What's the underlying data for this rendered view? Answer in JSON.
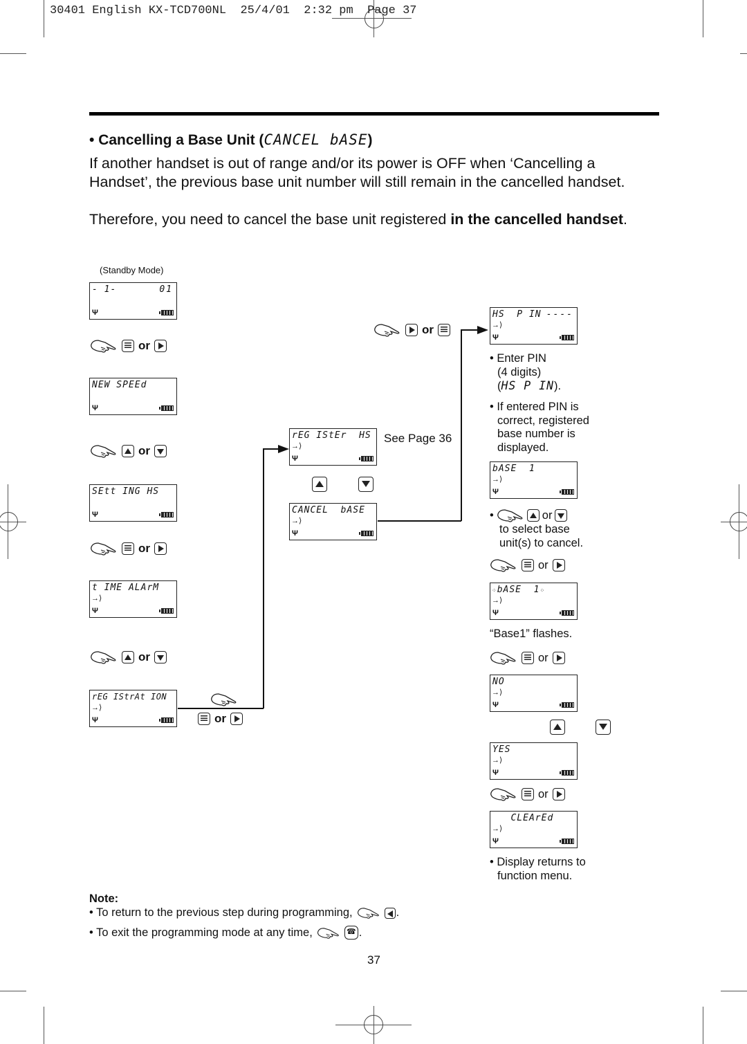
{
  "print_header": "30401 English KX-TCD700NL  25/4/01  2:32 pm  Page 37",
  "section": {
    "bullet": "•",
    "title": "Cancelling a Base Unit (",
    "title_lcd": "CANCEL bASE",
    "title_close": ")"
  },
  "intro": {
    "para1": "If another handset is out of range and/or its power is OFF when ‘Cancelling a Handset’, the previous base unit number will still remain in the cancelled handset.",
    "para2_plain": "Therefore, you need to cancel the base unit registered ",
    "para2_bold": "in the cancelled handset",
    "para2_end": "."
  },
  "standby_label": "(Standby Mode)",
  "or_label": "or",
  "left_column": {
    "displays": [
      {
        "line1": "- 1-",
        "right": "01",
        "arrow": false
      },
      {
        "line1": "NEW SPEEd",
        "arrow": false
      },
      {
        "line1": "SEtt ING HS",
        "arrow": false
      },
      {
        "line1": "t IME ALArM",
        "arrow": true
      },
      {
        "line1": "rEG IStrAt ION",
        "arrow": true
      }
    ],
    "steps": [
      {
        "keys": [
          "menu",
          "right"
        ]
      },
      {
        "keys": [
          "up",
          "down"
        ]
      },
      {
        "keys": [
          "menu",
          "right"
        ]
      },
      {
        "keys": [
          "up",
          "down"
        ]
      },
      {
        "keys": [
          "menu",
          "right"
        ]
      }
    ]
  },
  "middle_column": {
    "displays": [
      {
        "line1": "rEG IStEr  HS",
        "arrow": true
      },
      {
        "line1": "CANCEL  bASE",
        "arrow": true
      }
    ],
    "see_page": "See Page 36",
    "step_top": {
      "keys": [
        "right",
        "menu"
      ]
    }
  },
  "right_column": {
    "displays": [
      {
        "line1": "HS  P IN",
        "right": "----",
        "arrow": true
      },
      {
        "line1": "bASE  1",
        "arrow": true
      },
      {
        "line1": "bASE  1",
        "arrow": true,
        "flashing": true
      },
      {
        "line1": "NO",
        "arrow": true
      },
      {
        "line1": "YES",
        "arrow": true
      },
      {
        "line1": "   CLEArEd",
        "arrow": true
      }
    ],
    "enter_pin": "• Enter PIN",
    "enter_pin_digits": "(4 digits)",
    "enter_pin_lcd_open": "(",
    "enter_pin_lcd": "HS P IN",
    "enter_pin_lcd_close": ").",
    "pin_correct": [
      "• If entered PIN is",
      "correct, registered",
      "base number is",
      "displayed."
    ],
    "select_bullet": "•",
    "select_text": [
      "to select base",
      "unit(s) to cancel."
    ],
    "flashes": "“Base1” flashes.",
    "returns": [
      "• Display returns to",
      "function menu."
    ]
  },
  "note": {
    "title": "Note:",
    "items": [
      {
        "text": "• To return to the previous step during programming,",
        "key": "left",
        "end": "."
      },
      {
        "text": "• To exit the programming mode at any time,",
        "key": "off-hook",
        "end": "."
      }
    ]
  },
  "page_number": "37"
}
